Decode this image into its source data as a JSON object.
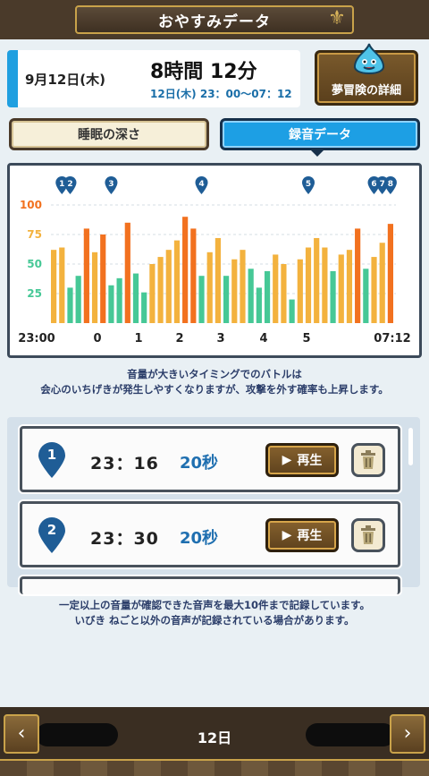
{
  "header": {
    "title": "おやすみデータ"
  },
  "summary": {
    "date": "9月12日(木)",
    "duration_hours": "8時間 12分",
    "time_range": "12日(木) 23：00～07：12",
    "detail_button": "夢冒険の詳細"
  },
  "tabs": [
    {
      "label": "睡眠の深さ",
      "active": false
    },
    {
      "label": "録音データ",
      "active": true
    }
  ],
  "chart_data": {
    "type": "bar",
    "y_ticks": [
      "100",
      "75",
      "50",
      "25"
    ],
    "ylim": [
      0,
      100
    ],
    "x_labels": [
      "23:00",
      "0",
      "1",
      "2",
      "3",
      "4",
      "5",
      "07:12"
    ],
    "markers": [
      "1",
      "2",
      "3",
      "4",
      "5",
      "6",
      "7",
      "8"
    ],
    "colors": {
      "high": "#f2711f",
      "mid": "#f3b23e",
      "low": "#46c896"
    },
    "values": [
      62,
      64,
      30,
      40,
      80,
      60,
      75,
      32,
      38,
      85,
      42,
      26,
      50,
      56,
      62,
      70,
      90,
      80,
      40,
      60,
      72,
      40,
      54,
      62,
      46,
      30,
      44,
      58,
      50,
      20,
      54,
      64,
      72,
      64,
      44,
      58,
      62,
      80,
      46,
      56,
      68,
      84
    ]
  },
  "notes": {
    "battle_line1": "音量が大きいタイミングでのバトルは",
    "battle_line2": "会心のいちげきが発生しやすくなりますが、攻撃を外す確率も上昇します。",
    "record_line1": "一定以上の音量が確認できた音声を最大10件まで記録しています。",
    "record_line2": "いびき ねごと以外の音声が記録されている場合があります。"
  },
  "recordings": [
    {
      "index": "1",
      "time": "23：16",
      "duration": "20秒",
      "play_label": "再生"
    },
    {
      "index": "2",
      "time": "23：30",
      "duration": "20秒",
      "play_label": "再生"
    }
  ],
  "nav": {
    "day_label": "12日"
  }
}
